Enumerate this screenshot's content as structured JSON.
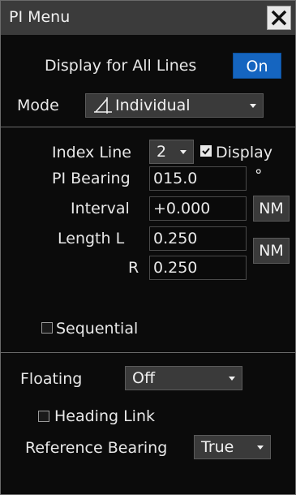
{
  "window": {
    "title": "PI Menu",
    "close_icon": "close-icon"
  },
  "display_all": {
    "label": "Display for All Lines",
    "state": "On"
  },
  "mode": {
    "label": "Mode",
    "value": "Individual",
    "icon": "individual-mode-icon"
  },
  "index_line": {
    "label": "Index Line",
    "value": "2",
    "display_label": "Display",
    "display_checked": true
  },
  "pi_bearing": {
    "label": "PI Bearing",
    "value": "015.0",
    "unit": "°"
  },
  "interval": {
    "label": "Interval",
    "value": "+0.000",
    "unit": "NM"
  },
  "length": {
    "label": "Length L",
    "l_value": "0.250",
    "r_label": "R",
    "r_value": "0.250",
    "unit": "NM"
  },
  "sequential": {
    "label": "Sequential",
    "checked": false
  },
  "floating": {
    "label": "Floating",
    "value": "Off"
  },
  "heading_link": {
    "label": "Heading Link",
    "checked": false
  },
  "reference_bearing": {
    "label": "Reference Bearing",
    "value": "True"
  },
  "colors": {
    "accent": "#1565c0",
    "background": "#0b0b0b",
    "titlebar": "#3b3b3b"
  }
}
